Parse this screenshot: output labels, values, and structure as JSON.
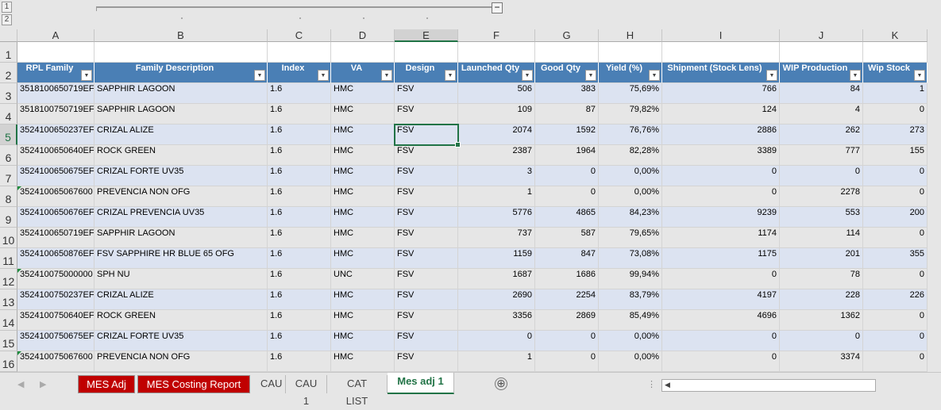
{
  "outline": {
    "levels": [
      "1",
      "2"
    ],
    "collapse": "−"
  },
  "columns": [
    "A",
    "B",
    "C",
    "D",
    "E",
    "F",
    "G",
    "H",
    "I",
    "J",
    "K"
  ],
  "selected_cell": "E5",
  "headers": [
    "RPL Family",
    "Family Description",
    "Index",
    "VA",
    "Design",
    "Launched Qty",
    "Good Qty",
    "Yield (%)",
    "Shipment (Stock Lens)",
    "WIP Production",
    "Wip Stock"
  ],
  "rows": [
    [
      "3",
      "3518100650719EF",
      "SAPPHIR LAGOON",
      "1.6",
      "HMC",
      "FSV",
      "506",
      "383",
      "75,69%",
      "766",
      "84",
      "1",
      false
    ],
    [
      "4",
      "3518100750719EF",
      "SAPPHIR LAGOON",
      "1.6",
      "HMC",
      "FSV",
      "109",
      "87",
      "79,82%",
      "124",
      "4",
      "0",
      false
    ],
    [
      "5",
      "3524100650237EF",
      "CRIZAL ALIZE",
      "1.6",
      "HMC",
      "FSV",
      "2074",
      "1592",
      "76,76%",
      "2886",
      "262",
      "273",
      false
    ],
    [
      "6",
      "3524100650640EF",
      "ROCK GREEN",
      "1.6",
      "HMC",
      "FSV",
      "2387",
      "1964",
      "82,28%",
      "3389",
      "777",
      "155",
      false
    ],
    [
      "7",
      "3524100650675EF",
      "CRIZAL FORTE UV35",
      "1.6",
      "HMC",
      "FSV",
      "3",
      "0",
      "0,00%",
      "0",
      "0",
      "0",
      false
    ],
    [
      "8",
      "352410065067600",
      "PREVENCIA NON OFG",
      "1.6",
      "HMC",
      "FSV",
      "1",
      "0",
      "0,00%",
      "0",
      "2278",
      "0",
      true
    ],
    [
      "9",
      "3524100650676EF",
      "CRIZAL PREVENCIA UV35",
      "1.6",
      "HMC",
      "FSV",
      "5776",
      "4865",
      "84,23%",
      "9239",
      "553",
      "200",
      false
    ],
    [
      "10",
      "3524100650719EF",
      "SAPPHIR LAGOON",
      "1.6",
      "HMC",
      "FSV",
      "737",
      "587",
      "79,65%",
      "1174",
      "114",
      "0",
      false
    ],
    [
      "11",
      "3524100650876EF",
      "FSV SAPPHIRE HR BLUE 65 OFG",
      "1.6",
      "HMC",
      "FSV",
      "1159",
      "847",
      "73,08%",
      "1175",
      "201",
      "355",
      false
    ],
    [
      "12",
      "352410075000000",
      "SPH NU",
      "1.6",
      "UNC",
      "FSV",
      "1687",
      "1686",
      "99,94%",
      "0",
      "78",
      "0",
      true
    ],
    [
      "13",
      "3524100750237EF",
      "CRIZAL ALIZE",
      "1.6",
      "HMC",
      "FSV",
      "2690",
      "2254",
      "83,79%",
      "4197",
      "228",
      "226",
      false
    ],
    [
      "14",
      "3524100750640EF",
      "ROCK GREEN",
      "1.6",
      "HMC",
      "FSV",
      "3356",
      "2869",
      "85,49%",
      "4696",
      "1362",
      "0",
      false
    ],
    [
      "15",
      "3524100750675EF",
      "CRIZAL FORTE UV35",
      "1.6",
      "HMC",
      "FSV",
      "0",
      "0",
      "0,00%",
      "0",
      "0",
      "0",
      false
    ],
    [
      "16",
      "352410075067600",
      "PREVENCIA NON OFG",
      "1.6",
      "HMC",
      "FSV",
      "1",
      "0",
      "0,00%",
      "0",
      "3374",
      "0",
      true
    ]
  ],
  "sheets": [
    {
      "label": "MES Adj",
      "style": "red"
    },
    {
      "label": "MES Costing Report",
      "style": "red"
    },
    {
      "label": "CAU",
      "style": "normal"
    },
    {
      "label": "CAU 1",
      "style": "normal"
    },
    {
      "label": "CAT LIST",
      "style": "normal"
    },
    {
      "label": "Mes adj 1",
      "style": "active"
    }
  ],
  "add_sheet": "⊕",
  "colors": {
    "header": "#4a7fb5",
    "band": "#dce3f1",
    "accent": "#217346",
    "tab_red": "#c00000"
  }
}
